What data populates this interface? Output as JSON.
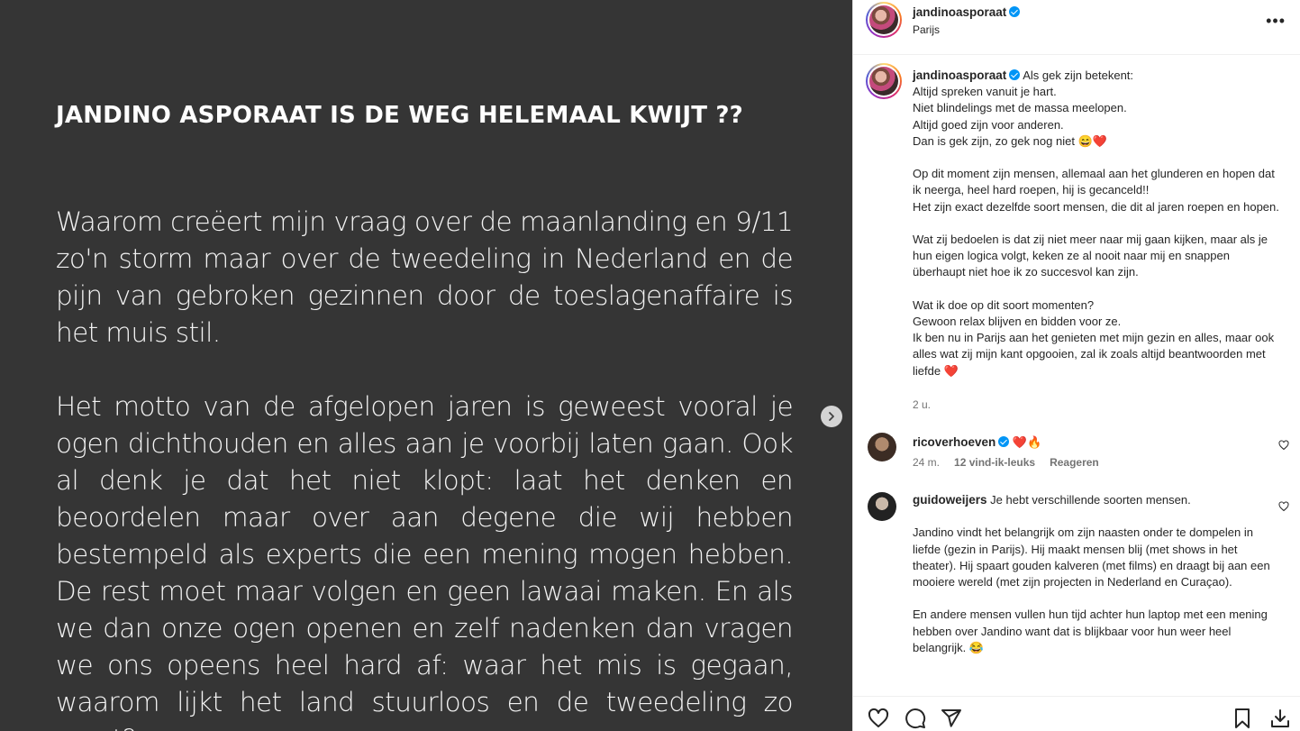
{
  "post": {
    "title": "JANDINO ASPORAAT IS DE WEG HELEMAAL KWIJT ??",
    "paragraph1": "Waarom creëert mijn vraag over de maanlanding en 9/11 zo'n storm maar over de tweedeling in Nederland en de pijn van gebroken gezinnen door de toeslagenaffaire is het muis stil.",
    "paragraph2": "Het motto van de afgelopen jaren is geweest vooral je ogen dichthouden en alles aan je voorbij laten gaan. Ook al denk je dat het niet klopt: laat het denken en beoordelen maar over aan degene die wij hebben bestempeld als experts die een mening mogen hebben. De rest moet maar volgen en geen lawaai maken. En als we dan onze ogen openen en zelf nadenken dan vragen we ons opeens heel hard af: waar het mis is gegaan, waarom lijkt het land stuurloos en de tweedeling zo groot?"
  },
  "header": {
    "username": "jandinoasporaat",
    "location": "Parijs",
    "more": "•••"
  },
  "caption": {
    "username": "jandinoasporaat",
    "text": "Als gek zijn betekent:\nAltijd spreken vanuit je hart.\nNiet blindelings met de massa meelopen.\nAltijd goed zijn voor anderen.\nDan is gek zijn, zo gek nog niet 😄❤️\n\nOp dit moment zijn mensen, allemaal aan het glunderen en hopen dat ik neerga, heel hard roepen, hij is gecanceld!!\nHet zijn exact dezelfde soort mensen, die dit al jaren roepen en hopen.\n\nWat zij bedoelen is dat zij niet meer naar mij gaan kijken, maar als je hun eigen logica volgt, keken ze al nooit naar mij en snappen überhaupt niet hoe ik zo succesvol kan zijn.\n\nWat ik doe op dit soort momenten?\nGewoon relax blijven en bidden voor ze.\nIk ben nu in Parijs aan het genieten met mijn gezin en alles, maar ook alles wat zij mijn kant opgooien, zal ik zoals altijd beantwoorden met liefde ❤️",
    "time": "2 u."
  },
  "comments": [
    {
      "username": "ricoverhoeven",
      "text": "❤️🔥",
      "time": "24 m.",
      "likes": "12 vind-ik-leuks",
      "reply": "Reageren"
    },
    {
      "username": "guidoweijers",
      "text": "Je hebt verschillende soorten mensen.\n\nJandino vindt het belangrijk om zijn naasten onder te dompelen in liefde (gezin in Parijs). Hij maakt mensen blij (met shows in het theater). Hij spaart gouden kalveren (met films) en draagt bij aan een mooiere wereld (met zijn projecten in Nederland en Curaçao).\n\nEn andere mensen vullen hun tijd achter hun laptop met een mening hebben over Jandino want dat is blijkbaar voor hun weer heel belangrijk. 😂"
    }
  ],
  "icons": {
    "next": "chevron-right-icon",
    "like": "heart-icon",
    "comment": "comment-icon",
    "share": "share-icon",
    "save": "bookmark-icon",
    "download": "download-icon",
    "verified": "verified-badge-icon"
  },
  "colors": {
    "post_background": "#353535",
    "verified": "#0095f6",
    "muted_text": "#737373"
  }
}
